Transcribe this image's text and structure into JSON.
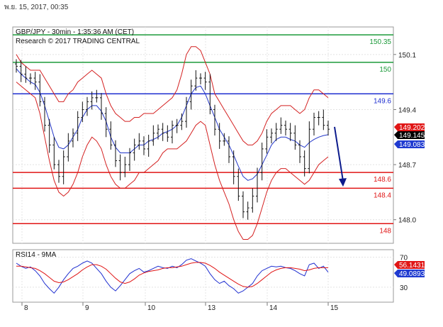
{
  "page": {
    "timestamp": "พ.ย. 15, 2017, 00:35"
  },
  "chart_data": [
    {
      "type": "candlestick",
      "title": "GBP/JPY - 30min - 1:35:36 AM (CET)",
      "subtitle": "Research © 2017 TRADING CENTRAL",
      "ylim": [
        147.7,
        150.45
      ],
      "y_ticks": [
        "150.1",
        "149.4",
        "148.7",
        "148.0"
      ],
      "x_labels": [
        "8",
        "9",
        "10",
        "13",
        "14",
        "15"
      ],
      "levels": [
        {
          "label": "150.35",
          "value": 150.35,
          "color": "#1c9a3a"
        },
        {
          "label": "150",
          "value": 150.0,
          "color": "#1c9a3a"
        },
        {
          "label": "149.6",
          "value": 149.6,
          "color": "#1f2fd0"
        },
        {
          "label": "148.6",
          "value": 148.6,
          "color": "#e01515"
        },
        {
          "label": "148.4",
          "value": 148.4,
          "color": "#e01515"
        },
        {
          "label": "148",
          "value": 147.95,
          "color": "#e01515"
        }
      ],
      "price_tags": [
        {
          "label": "149.202",
          "value": 149.202,
          "bg": "#e01515",
          "fg": "#ffffff"
        },
        {
          "label": "149.145",
          "value": 149.145,
          "bg": "#000000",
          "fg": "#ffffff"
        },
        {
          "label": "149.083",
          "value": 149.083,
          "bg": "#1f3ad0",
          "fg": "#ffffff"
        }
      ],
      "close": [
        149.95,
        149.85,
        149.8,
        149.8,
        149.75,
        149.5,
        149.2,
        148.95,
        148.7,
        148.55,
        148.8,
        149.0,
        149.1,
        149.3,
        149.4,
        149.5,
        149.55,
        149.55,
        149.35,
        149.15,
        148.95,
        148.75,
        148.6,
        148.7,
        148.85,
        148.95,
        149.0,
        148.9,
        149.0,
        149.1,
        149.15,
        149.1,
        149.05,
        149.2,
        149.2,
        149.25,
        149.5,
        149.7,
        149.8,
        149.8,
        149.75,
        149.4,
        149.15,
        149.0,
        149.0,
        148.8,
        148.55,
        148.3,
        148.1,
        148.15,
        148.3,
        148.6,
        148.9,
        149.05,
        149.1,
        149.15,
        149.2,
        149.15,
        149.1,
        148.95,
        148.8,
        148.65,
        149.15,
        149.3,
        149.3,
        149.2,
        149.15
      ],
      "upper_band": [
        150.1,
        150.0,
        149.95,
        149.9,
        149.9,
        149.9,
        149.8,
        149.7,
        149.6,
        149.5,
        149.5,
        149.6,
        149.65,
        149.75,
        149.8,
        149.85,
        149.9,
        149.85,
        149.8,
        149.6,
        149.45,
        149.35,
        149.3,
        149.25,
        149.25,
        149.3,
        149.3,
        149.35,
        149.35,
        149.35,
        149.4,
        149.45,
        149.5,
        149.55,
        149.65,
        149.85,
        150.1,
        150.2,
        150.2,
        150.15,
        150.0,
        149.85,
        149.6,
        149.5,
        149.4,
        149.3,
        149.2,
        149.1,
        149.0,
        148.95,
        148.95,
        149.0,
        149.1,
        149.25,
        149.35,
        149.4,
        149.45,
        149.45,
        149.45,
        149.4,
        149.35,
        149.4,
        149.55,
        149.65,
        149.65,
        149.6,
        149.55
      ],
      "lower_band": [
        149.75,
        149.7,
        149.65,
        149.6,
        149.55,
        149.35,
        149.05,
        148.75,
        148.5,
        148.35,
        148.3,
        148.35,
        148.45,
        148.6,
        148.8,
        148.95,
        149.05,
        149.0,
        148.9,
        148.7,
        148.55,
        148.45,
        148.4,
        148.4,
        148.45,
        148.5,
        148.6,
        148.6,
        148.65,
        148.7,
        148.75,
        148.85,
        148.9,
        148.9,
        148.9,
        148.95,
        149.0,
        149.1,
        149.2,
        149.25,
        149.2,
        148.95,
        148.7,
        148.5,
        148.35,
        148.2,
        148.0,
        147.85,
        147.75,
        147.75,
        147.8,
        147.95,
        148.15,
        148.35,
        148.5,
        148.6,
        148.65,
        148.65,
        148.6,
        148.55,
        148.5,
        148.45,
        148.5,
        148.6,
        148.7,
        148.75,
        148.8
      ],
      "ma": [
        149.92,
        149.85,
        149.8,
        149.75,
        149.72,
        149.62,
        149.45,
        149.25,
        149.05,
        148.92,
        148.9,
        148.95,
        149.05,
        149.15,
        149.3,
        149.4,
        149.45,
        149.45,
        149.38,
        149.25,
        149.05,
        148.92,
        148.85,
        148.85,
        148.85,
        148.9,
        148.95,
        148.95,
        149.0,
        149.02,
        149.05,
        149.1,
        149.12,
        149.15,
        149.2,
        149.3,
        149.45,
        149.6,
        149.68,
        149.7,
        149.6,
        149.45,
        149.3,
        149.15,
        149.05,
        148.95,
        148.82,
        148.68,
        148.55,
        148.5,
        148.52,
        148.58,
        148.7,
        148.82,
        148.95,
        149.02,
        149.05,
        149.05,
        149.02,
        149.0,
        148.95,
        148.92,
        148.98,
        149.02,
        149.05,
        149.07,
        149.08
      ],
      "forecast_arrow": {
        "from": 149.18,
        "to": 148.42
      }
    },
    {
      "type": "line",
      "title": "RSI14 - 9MA",
      "ylim": [
        10,
        80
      ],
      "y_ticks": [
        "70",
        "30"
      ],
      "tags": [
        {
          "label": "56.1431",
          "value": 56.1431,
          "bg": "#e01515",
          "fg": "#ffffff"
        },
        {
          "label": "49.0893",
          "value": 49.0893,
          "bg": "#1f3ad0",
          "fg": "#ffffff"
        }
      ],
      "series": [
        {
          "color": "#1f2fd0",
          "values": [
            62,
            58,
            55,
            57,
            52,
            45,
            35,
            28,
            22,
            30,
            40,
            48,
            55,
            58,
            62,
            65,
            62,
            55,
            48,
            38,
            30,
            25,
            32,
            40,
            48,
            52,
            55,
            50,
            52,
            55,
            58,
            56,
            55,
            58,
            56,
            60,
            66,
            68,
            65,
            62,
            58,
            48,
            40,
            35,
            38,
            32,
            28,
            22,
            25,
            30,
            35,
            45,
            52,
            55,
            58,
            57,
            58,
            56,
            55,
            52,
            48,
            45,
            60,
            62,
            55,
            58,
            50
          ]
        },
        {
          "color": "#e01515",
          "values": [
            58,
            58,
            57,
            56,
            55,
            52,
            48,
            43,
            38,
            36,
            37,
            40,
            44,
            48,
            53,
            57,
            60,
            60,
            58,
            54,
            48,
            42,
            37,
            35,
            37,
            41,
            46,
            49,
            51,
            52,
            53,
            55,
            56,
            56,
            57,
            58,
            60,
            62,
            63,
            63,
            62,
            59,
            55,
            50,
            46,
            42,
            38,
            34,
            31,
            30,
            31,
            35,
            40,
            45,
            50,
            53,
            55,
            56,
            56,
            55,
            54,
            52,
            53,
            55,
            56,
            56,
            56
          ]
        }
      ]
    }
  ]
}
